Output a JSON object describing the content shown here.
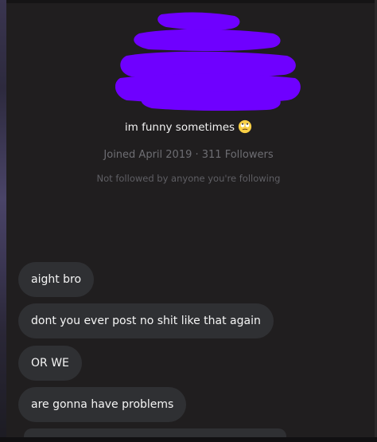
{
  "profile": {
    "bio": "im funny sometimes",
    "bio_emoji": "rolling-eyes-emoji",
    "meta": "Joined April 2019 · 311 Followers",
    "follow_note": "Not followed by anyone you're following",
    "redaction_color": "#6f00ff"
  },
  "messages": [
    {
      "text": "aight bro"
    },
    {
      "text": "dont you ever post no shit like that again"
    },
    {
      "text": "OR WE"
    },
    {
      "text": "are gonna have problems"
    }
  ],
  "colors": {
    "background": "#201e1f",
    "bubble": "#2f3033",
    "text": "#f5f5f5",
    "muted": "#6e6e73"
  }
}
